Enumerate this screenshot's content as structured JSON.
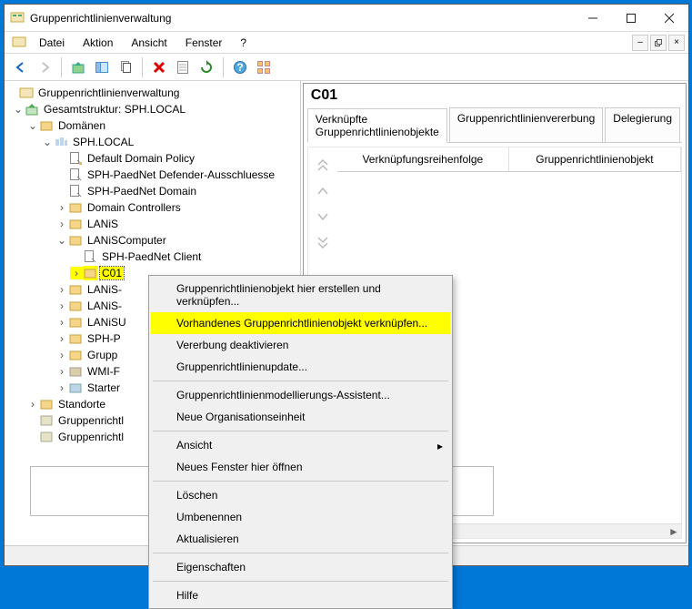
{
  "title": "Gruppenrichtlinienverwaltung",
  "window_controls": {
    "min": "min",
    "max": "max",
    "close": "close"
  },
  "menu": {
    "datei": "Datei",
    "aktion": "Aktion",
    "ansicht": "Ansicht",
    "fenster": "Fenster",
    "hilfe": "?"
  },
  "toolbar": {
    "back": "back",
    "forward": "forward",
    "up": "up",
    "show_hide": "show-hide",
    "copy": "copy",
    "delete": "delete",
    "properties": "properties",
    "refresh": "refresh",
    "help": "help",
    "tile": "tile"
  },
  "tree": {
    "root": "Gruppenrichtlinienverwaltung",
    "forest": "Gesamtstruktur: SPH.LOCAL",
    "domains": "Domänen",
    "domain": "SPH.LOCAL",
    "ddp": "Default Domain Policy",
    "def_excl": "SPH-PaedNet Defender-Ausschluesse",
    "pn_domain": "SPH-PaedNet Domain",
    "dc": "Domain Controllers",
    "lanis": "LANiS",
    "lanis_comp": "LANiSComputer",
    "pn_client": "SPH-PaedNet Client",
    "c01": "C01",
    "lanis_s1": "LANiS-",
    "lanis_s2": "LANiS-",
    "lanisu": "LANiSU",
    "sph_p": "SPH-P",
    "grupp": "Grupp",
    "wmi_f": "WMI-F",
    "starter": "Starter",
    "sites": "Standorte",
    "gpresultm": "Gruppenrichtl",
    "gpresulte": "Gruppenrichtl"
  },
  "detail": {
    "title": "C01",
    "tab1": "Verknüpfte Gruppenrichtlinienobjekte",
    "tab2": "Gruppenrichtlinienvererbung",
    "tab3": "Delegierung",
    "col1": "Verknüpfungsreihenfolge",
    "col2": "Gruppenrichtlinienobjekt"
  },
  "context": {
    "i1": "Gruppenrichtlinienobjekt hier erstellen und verknüpfen...",
    "i2": "Vorhandenes Gruppenrichtlinienobjekt verknüpfen...",
    "i3": "Vererbung deaktivieren",
    "i4": "Gruppenrichtlinienupdate...",
    "i5": "Gruppenrichtlinienmodellierungs-Assistent...",
    "i6": "Neue Organisationseinheit",
    "i7": "Ansicht",
    "i8": "Neues Fenster hier öffnen",
    "i9": "Löschen",
    "i10": "Umbenennen",
    "i11": "Aktualisieren",
    "i12": "Eigenschaften",
    "i13": "Hilfe"
  }
}
